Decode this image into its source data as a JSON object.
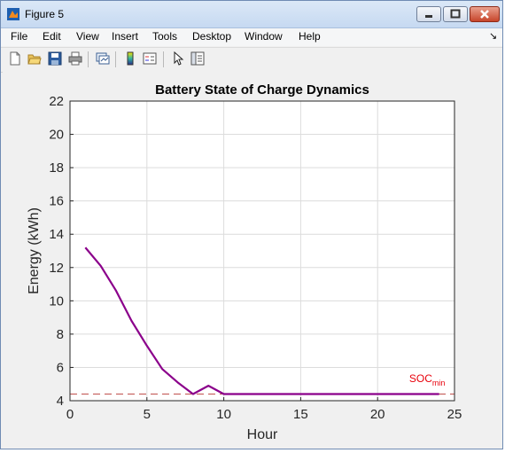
{
  "window": {
    "title": "Figure 5"
  },
  "menu": {
    "items": [
      "File",
      "Edit",
      "View",
      "Insert",
      "Tools",
      "Desktop",
      "Window",
      "Help"
    ]
  },
  "toolbar": {
    "icons": [
      "new-figure-icon",
      "open-file-icon",
      "save-icon",
      "print-icon",
      "link-plot-icon",
      "insert-colorbar-icon",
      "insert-legend-icon",
      "edit-plot-arrow-icon",
      "property-inspector-icon"
    ]
  },
  "colors": {
    "series": "#8b008b",
    "soc_line": "#c0504d",
    "soc_label": "#e8000b"
  },
  "chart_data": {
    "type": "line",
    "title": "Battery State of Charge Dynamics",
    "xlabel": "Hour",
    "ylabel": "Energy (kWh)",
    "xlim": [
      0,
      25
    ],
    "ylim": [
      4,
      22
    ],
    "xticks": [
      0,
      5,
      10,
      15,
      20,
      25
    ],
    "yticks": [
      4,
      6,
      8,
      10,
      12,
      14,
      16,
      18,
      20,
      22
    ],
    "grid": true,
    "series": [
      {
        "x": [
          1,
          2,
          3,
          4,
          5,
          6,
          7,
          8,
          9,
          10,
          11,
          12,
          13,
          14,
          15,
          16,
          17,
          18,
          19,
          20,
          21,
          22,
          23,
          24
        ],
        "values": [
          13.2,
          12.1,
          10.6,
          8.8,
          7.3,
          5.9,
          5.1,
          4.4,
          4.9,
          4.4,
          4.4,
          4.4,
          4.4,
          4.4,
          4.4,
          4.4,
          4.4,
          4.4,
          4.4,
          4.4,
          4.4,
          4.4,
          4.4,
          4.4
        ]
      }
    ],
    "reference_line": {
      "y": 4.4,
      "style": "dashed"
    },
    "annotation": {
      "text": "SOC",
      "subscript": "min",
      "x": 22,
      "y": 4.7
    }
  }
}
